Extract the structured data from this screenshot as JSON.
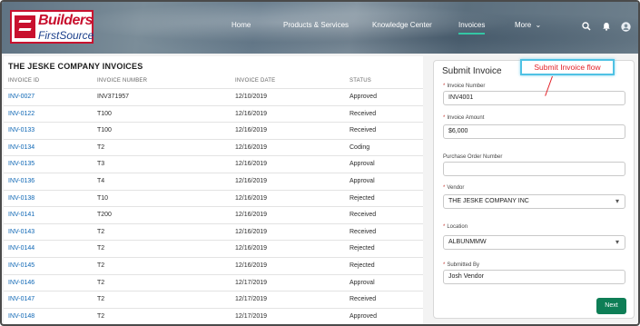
{
  "header": {
    "logo_line1": "Builders",
    "logo_line2": "FirstSource",
    "nav": [
      {
        "label": "Home"
      },
      {
        "label": "Products & Services"
      },
      {
        "label": "Knowledge Center"
      },
      {
        "label": "Invoices"
      },
      {
        "label": "More"
      }
    ],
    "icons": [
      "search-icon",
      "bell-icon",
      "user-avatar-icon"
    ]
  },
  "invoices": {
    "title": "THE JESKE COMPANY INVOICES",
    "columns": [
      "INVOICE ID",
      "INVOICE NUMBER",
      "INVOICE DATE",
      "STATUS"
    ],
    "rows": [
      {
        "id": "INV-0027",
        "number": "INV371957",
        "date": "12/10/2019",
        "status": "Approved"
      },
      {
        "id": "INV-0122",
        "number": "T100",
        "date": "12/16/2019",
        "status": "Received"
      },
      {
        "id": "INV-0133",
        "number": "T100",
        "date": "12/16/2019",
        "status": "Received"
      },
      {
        "id": "INV-0134",
        "number": "T2",
        "date": "12/16/2019",
        "status": "Coding"
      },
      {
        "id": "INV-0135",
        "number": "T3",
        "date": "12/16/2019",
        "status": "Approval"
      },
      {
        "id": "INV-0136",
        "number": "T4",
        "date": "12/16/2019",
        "status": "Approval"
      },
      {
        "id": "INV-0138",
        "number": "T10",
        "date": "12/16/2019",
        "status": "Rejected"
      },
      {
        "id": "INV-0141",
        "number": "T200",
        "date": "12/16/2019",
        "status": "Received"
      },
      {
        "id": "INV-0143",
        "number": "T2",
        "date": "12/16/2019",
        "status": "Received"
      },
      {
        "id": "INV-0144",
        "number": "T2",
        "date": "12/16/2019",
        "status": "Rejected"
      },
      {
        "id": "INV-0145",
        "number": "T2",
        "date": "12/16/2019",
        "status": "Rejected"
      },
      {
        "id": "INV-0146",
        "number": "T2",
        "date": "12/17/2019",
        "status": "Approval"
      },
      {
        "id": "INV-0147",
        "number": "T2",
        "date": "12/17/2019",
        "status": "Received"
      },
      {
        "id": "INV-0148",
        "number": "T2",
        "date": "12/17/2019",
        "status": "Approved"
      }
    ]
  },
  "submit": {
    "title": "Submit Invoice",
    "callout": "Submit Invoice flow",
    "fields": {
      "invoice_number": {
        "label": "Invoice Number",
        "value": "INV4001"
      },
      "invoice_amount": {
        "label": "Invoice Amount",
        "value": "$6,000"
      },
      "po_number": {
        "label": "Purchase Order Number",
        "value": ""
      },
      "vendor": {
        "label": "Vendor",
        "value": "THE JESKE COMPANY INC"
      },
      "location": {
        "label": "Location",
        "value": "ALBUNMMW"
      },
      "submitted_by": {
        "label": "Submitted By",
        "value": "Josh Vendor"
      }
    },
    "next_label": "Next"
  },
  "colors": {
    "link": "#0b65b4",
    "primary_button": "#0e7e56",
    "brand_red": "#c8102e",
    "callout_text": "#e21f26"
  }
}
